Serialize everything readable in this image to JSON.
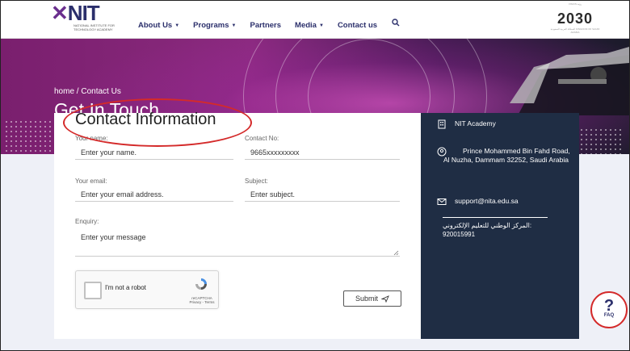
{
  "header": {
    "logo_text": "NIT",
    "logo_subtext": "NATIONAL INSTITUTE FOR TECHNOLOGY ACADEMY",
    "nav": [
      {
        "label": "About Us",
        "dropdown": true
      },
      {
        "label": "Programs",
        "dropdown": true
      },
      {
        "label": "Partners",
        "dropdown": false
      },
      {
        "label": "Media",
        "dropdown": true
      },
      {
        "label": "Contact us",
        "dropdown": false
      }
    ],
    "vision_logo_text": "2030",
    "vision_top": "VISION رؤية",
    "vision_sub": "المملكة العربية السعودية KINGDOM OF SAUDI ARABIA"
  },
  "banner": {
    "breadcrumb": "home / Contact Us",
    "title": "Get In Touch"
  },
  "form": {
    "title": "Contact Information",
    "name_label": "Your name:",
    "name_value": "Enter your name.",
    "contact_label": "Contact No:",
    "contact_value": "9665xxxxxxxxx",
    "email_label": "Your email:",
    "email_value": "Enter your email address.",
    "subject_label": "Subject:",
    "subject_value": "Enter subject.",
    "enquiry_label": "Enquiry:",
    "enquiry_value": "Enter your message",
    "recaptcha_label": "I'm not a robot",
    "recaptcha_brand": "reCAPTCHA",
    "recaptcha_links": "Privacy - Terms",
    "submit_label": "Submit"
  },
  "side": {
    "org": "NIT Academy",
    "address": "Prince Mohammed Bin Fahd Road, Al Nuzha, Dammam 32252, Saudi Arabia",
    "email": "support@nita.edu.sa",
    "arabic": "المركز الوطني للتعليم الإلكتروني:",
    "phone": "920015991"
  },
  "faq": {
    "label": "FAQ",
    "symbol": "?"
  },
  "colors": {
    "navy": "#1f2d44",
    "brand": "#2b2f6b",
    "annotation": "#d42a2a",
    "banner": "#8a2a7e"
  }
}
